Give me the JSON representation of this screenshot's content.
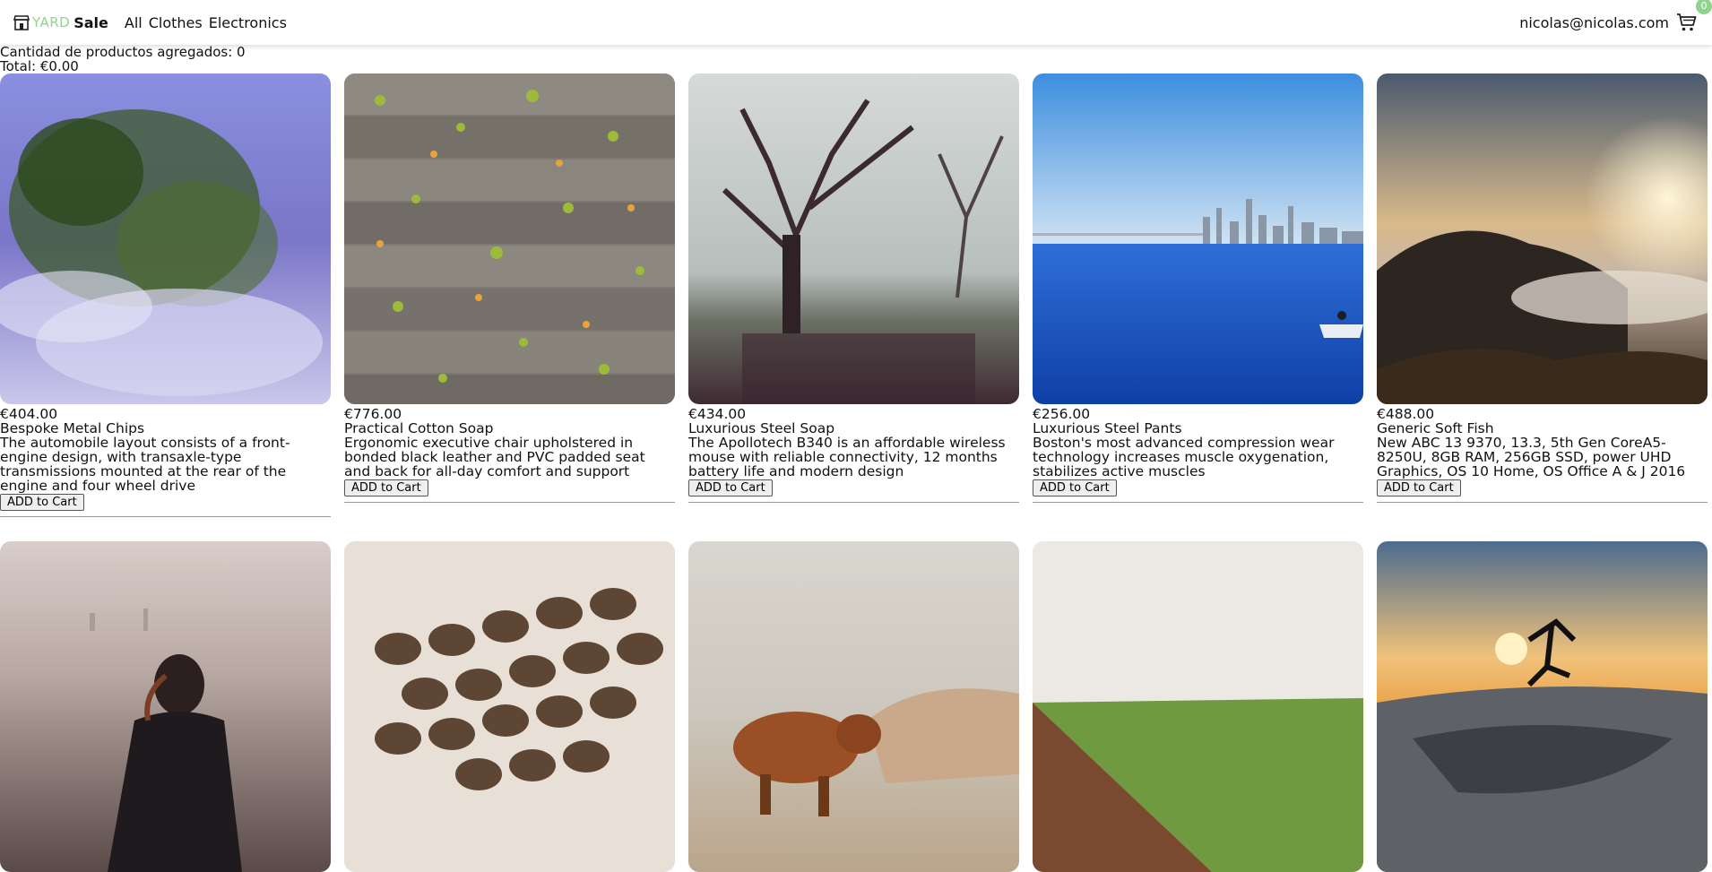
{
  "header": {
    "logo_yard": "YARD",
    "logo_sale": "Sale",
    "nav": [
      "All",
      "Clothes",
      "Electronics"
    ],
    "email": "nicolas@nicolas.com",
    "cart_count": "0",
    "cart_icon": "shopping-cart-icon",
    "accent": "#8fd38f"
  },
  "summary": {
    "count_text": "Cantidad de productos agregados: 0",
    "total_text": "Total: €0.00"
  },
  "products": [
    {
      "price": "€404.00",
      "name": "Bespoke Metal Chips",
      "description": "The automobile layout consists of a front-engine design, with transaxle-type transmissions mounted at the rear of the engine and four wheel drive",
      "button": "ADD to Cart",
      "image": "reflection-of-tree-in-water"
    },
    {
      "price": "€776.00",
      "name": "Practical Cotton Soap",
      "description": "Ergonomic executive chair upholstered in bonded black leather and PVC padded seat and back for all-day comfort and support",
      "button": "ADD to Cart",
      "image": "leaves-on-wooden-planks"
    },
    {
      "price": "€434.00",
      "name": "Luxurious Steel Soap",
      "description": "The Apollotech B340 is an affordable wireless mouse with reliable connectivity, 12 months battery life and modern design",
      "button": "ADD to Cart",
      "image": "tree-in-foggy-park"
    },
    {
      "price": "€256.00",
      "name": "Luxurious Steel Pants",
      "description": "Boston's most advanced compression wear technology increases muscle oxygenation, stabilizes active muscles",
      "button": "ADD to Cart",
      "image": "city-skyline-over-water"
    },
    {
      "price": "€488.00",
      "name": "Generic Soft Fish",
      "description": "New ABC 13 9370, 13.3, 5th Gen CoreA5-8250U, 8GB RAM, 256GB SSD, power UHD Graphics, OS 10 Home, OS Office A & J 2016",
      "button": "ADD to Cart",
      "image": "sunset-over-foggy-hills"
    },
    {
      "image": "woman-overlooking-city"
    },
    {
      "image": "coffee-beans"
    },
    {
      "image": "highland-cow"
    },
    {
      "image": "plowed-and-green-field"
    },
    {
      "image": "skateboarder-at-sunset"
    }
  ]
}
